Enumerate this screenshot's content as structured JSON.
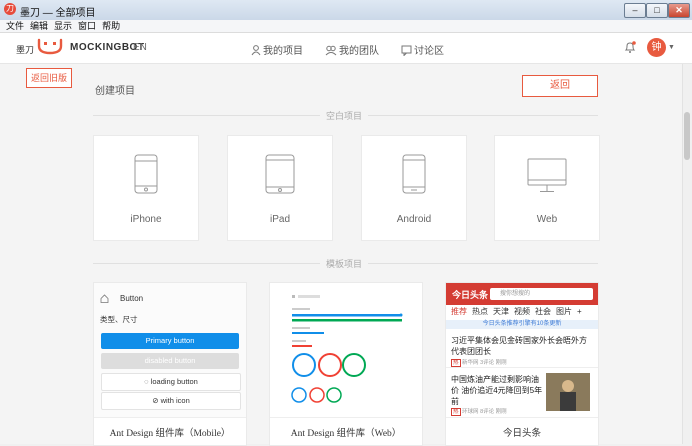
{
  "window": {
    "title": "墨刀 — 全部项目",
    "app_icon_text": "刀",
    "buttons": [
      "–",
      "□",
      "✕"
    ]
  },
  "menu": [
    "文件",
    "编辑",
    "显示",
    "窗口",
    "帮助"
  ],
  "header": {
    "brand_cn": "墨刀",
    "brand_en": "MOCKINGBOT",
    "lang": "EN",
    "nav": [
      "我的项目",
      "我的团队",
      "讨论区"
    ],
    "avatar": "钟",
    "caret": "▼"
  },
  "main": {
    "back_old_label": "返回旧版",
    "create_title": "创建项目",
    "back_label": "返回",
    "blank_section_label": "空白项目",
    "devices": [
      "iPhone",
      "iPad",
      "Android",
      "Web"
    ],
    "template_section_label": "模板项目",
    "templates": [
      {
        "title": "Ant Design 组件库（Mobile）"
      },
      {
        "title": "Ant Design 组件库（Web）"
      },
      {
        "title": "今日头条"
      }
    ],
    "ant_mobile": {
      "header": "Button",
      "subheader": "类型、尺寸",
      "primary": "Primary button",
      "disabled": "disabled button",
      "loading": "loading button",
      "icon": "with icon"
    },
    "toutiao": {
      "brand": "今日头条",
      "search_placeholder": "搜你想搜的",
      "tabs": [
        "推荐",
        "热点",
        "天津",
        "视频",
        "社会",
        "图片",
        "+"
      ],
      "notice": "今日头条推荐引擎有10条更新",
      "news": [
        {
          "title": "习近平集体会见金砖国家外长会晤外方代表团团长",
          "meta": "新华网 3评论 刚刚"
        },
        {
          "title": "中国炼油产能过剩影响油价 油价追近4元降回到5年前",
          "meta": "环球网 8评论 刚刚"
        }
      ]
    },
    "colors": {
      "accent": "#e85a3f",
      "toutiao_red": "#d43c33",
      "ant_blue": "#108ee9"
    }
  }
}
